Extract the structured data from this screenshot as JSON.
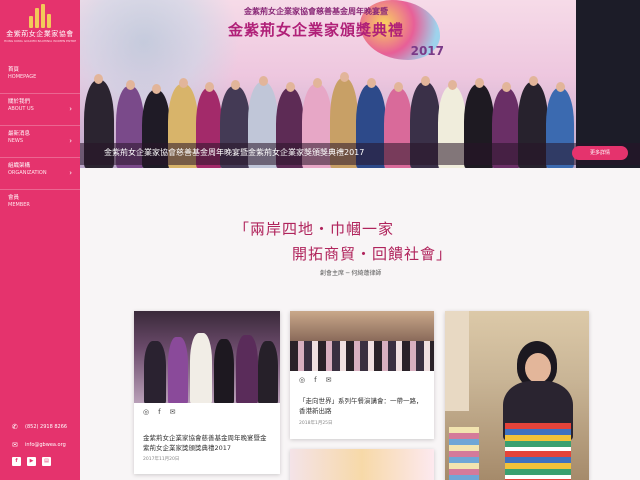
{
  "brand": {
    "name": "金紫荊女企業家協會",
    "subtitle": "HONG KONG GOLDEN BAUHINIA WOMEN ENTREPRENEUR ASSOCIATION"
  },
  "nav": {
    "items": [
      {
        "zh": "首頁",
        "en": "HOMEPAGE",
        "has_submenu": false
      },
      {
        "zh": "關於我們",
        "en": "ABOUT US",
        "has_submenu": true
      },
      {
        "zh": "最新消息",
        "en": "NEWS",
        "has_submenu": true
      },
      {
        "zh": "組織架構",
        "en": "ORGANIZATION",
        "has_submenu": true
      },
      {
        "zh": "會員",
        "en": "MEMBER",
        "has_submenu": false
      }
    ]
  },
  "contact": {
    "phone": "(852) 2918 8266",
    "email": "info@gbwea.org"
  },
  "social": {
    "facebook": "f",
    "youtube": "▶",
    "other": "▤"
  },
  "hero": {
    "banner_line1": "金紫荊女企業家協會慈善基金周年晚宴暨",
    "banner_line2": "金紫荊女企業家頒獎典禮",
    "banner_year": "2017",
    "caption": "金紫荊女企業家協會慈善基金周年晚宴暨金紫荊女企業家獎頒獎典禮2017",
    "more_button": "更多詳情"
  },
  "quote": {
    "line1": "「兩岸四地・巾幗一家",
    "line2": "開拓商貿・回饋社會」",
    "author": "創會主席 ─ 何綺蓮律師"
  },
  "cards": [
    {
      "title": "金紫荊女企業家協會慈善基金周年晚宴暨金紫荊女企業家獎頒獎典禮2017",
      "date": "2017年11月20日"
    },
    {
      "title": "「走向世界」系列午餐演講會：一帶一路，香港新出路",
      "date": "2018年1月25日"
    },
    {
      "title": "",
      "date": ""
    }
  ],
  "colors": {
    "brand_pink": "#e5336d",
    "quote_red": "#b0245c"
  },
  "icons": {
    "share": "weibo-icon",
    "facebook": "facebook-icon",
    "email": "mail-icon"
  }
}
